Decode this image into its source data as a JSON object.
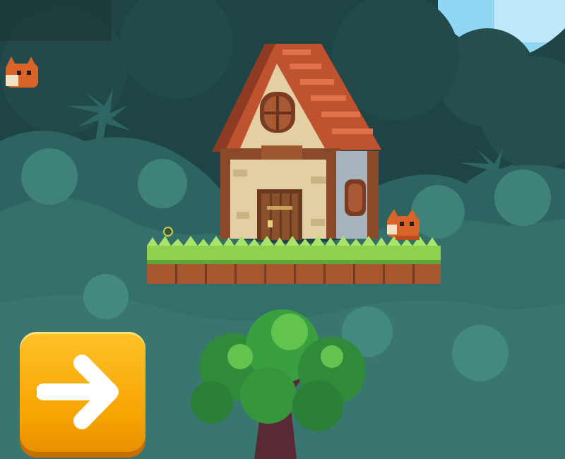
{
  "scene": {
    "name": "forest-cottage-level",
    "colors": {
      "sky": "#8fd7f2",
      "foliage_dark": "#1f4446",
      "foliage_mid": "#2f6a66",
      "foliage_light": "#3f827a",
      "grass": "#8fd14f",
      "dirt": "#a8582f",
      "roof": "#c0532f",
      "wall": "#e3cfa3",
      "button": "#f7a400"
    }
  },
  "hud": {
    "lives_icon": "fox-head-icon",
    "next_button_icon": "arrow-right-icon"
  }
}
